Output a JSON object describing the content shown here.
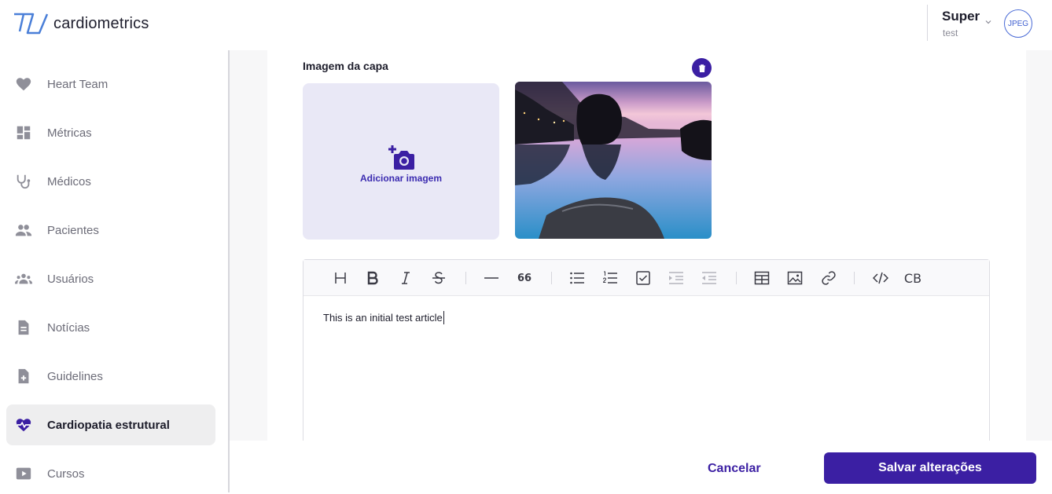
{
  "app": {
    "name": "cardiometrics"
  },
  "user": {
    "name": "Super",
    "role": "test",
    "avatar_text": "JPEG"
  },
  "sidebar": {
    "items": [
      {
        "label": "Heart Team",
        "icon": "heart-icon",
        "active": false
      },
      {
        "label": "Métricas",
        "icon": "dashboard-icon",
        "active": false
      },
      {
        "label": "Médicos",
        "icon": "stethoscope-icon",
        "active": false
      },
      {
        "label": "Pacientes",
        "icon": "people-icon",
        "active": false
      },
      {
        "label": "Usuários",
        "icon": "group-icon",
        "active": false
      },
      {
        "label": "Notícias",
        "icon": "document-icon",
        "active": false
      },
      {
        "label": "Guidelines",
        "icon": "add-document-icon",
        "active": false
      },
      {
        "label": "Cardiopatia estrutural",
        "icon": "heart-pulse-icon",
        "active": true
      },
      {
        "label": "Cursos",
        "icon": "play-icon",
        "active": false
      }
    ]
  },
  "cover": {
    "label": "Imagem da capa",
    "add_label": "Adicionar imagem"
  },
  "editor": {
    "content": "This is an initial test article",
    "toolbar": {
      "heading": "heading-icon",
      "bold": "bold-icon",
      "italic": "italic-icon",
      "strike": "strikethrough-icon",
      "hr": "horizontal-rule-icon",
      "quote_text": "66",
      "ul": "bullet-list-icon",
      "ol": "numbered-list-icon",
      "task": "task-list-icon",
      "indent": "indent-icon",
      "outdent": "outdent-icon",
      "table": "table-icon",
      "image": "image-icon",
      "link": "link-icon",
      "code": "code-icon",
      "codeblock_text": "CB"
    }
  },
  "footer": {
    "cancel_label": "Cancelar",
    "save_label": "Salvar alterações"
  },
  "colors": {
    "primary": "#3b1fa3",
    "upload_bg": "#e9e8f6",
    "active_bg": "#eeeeef"
  }
}
